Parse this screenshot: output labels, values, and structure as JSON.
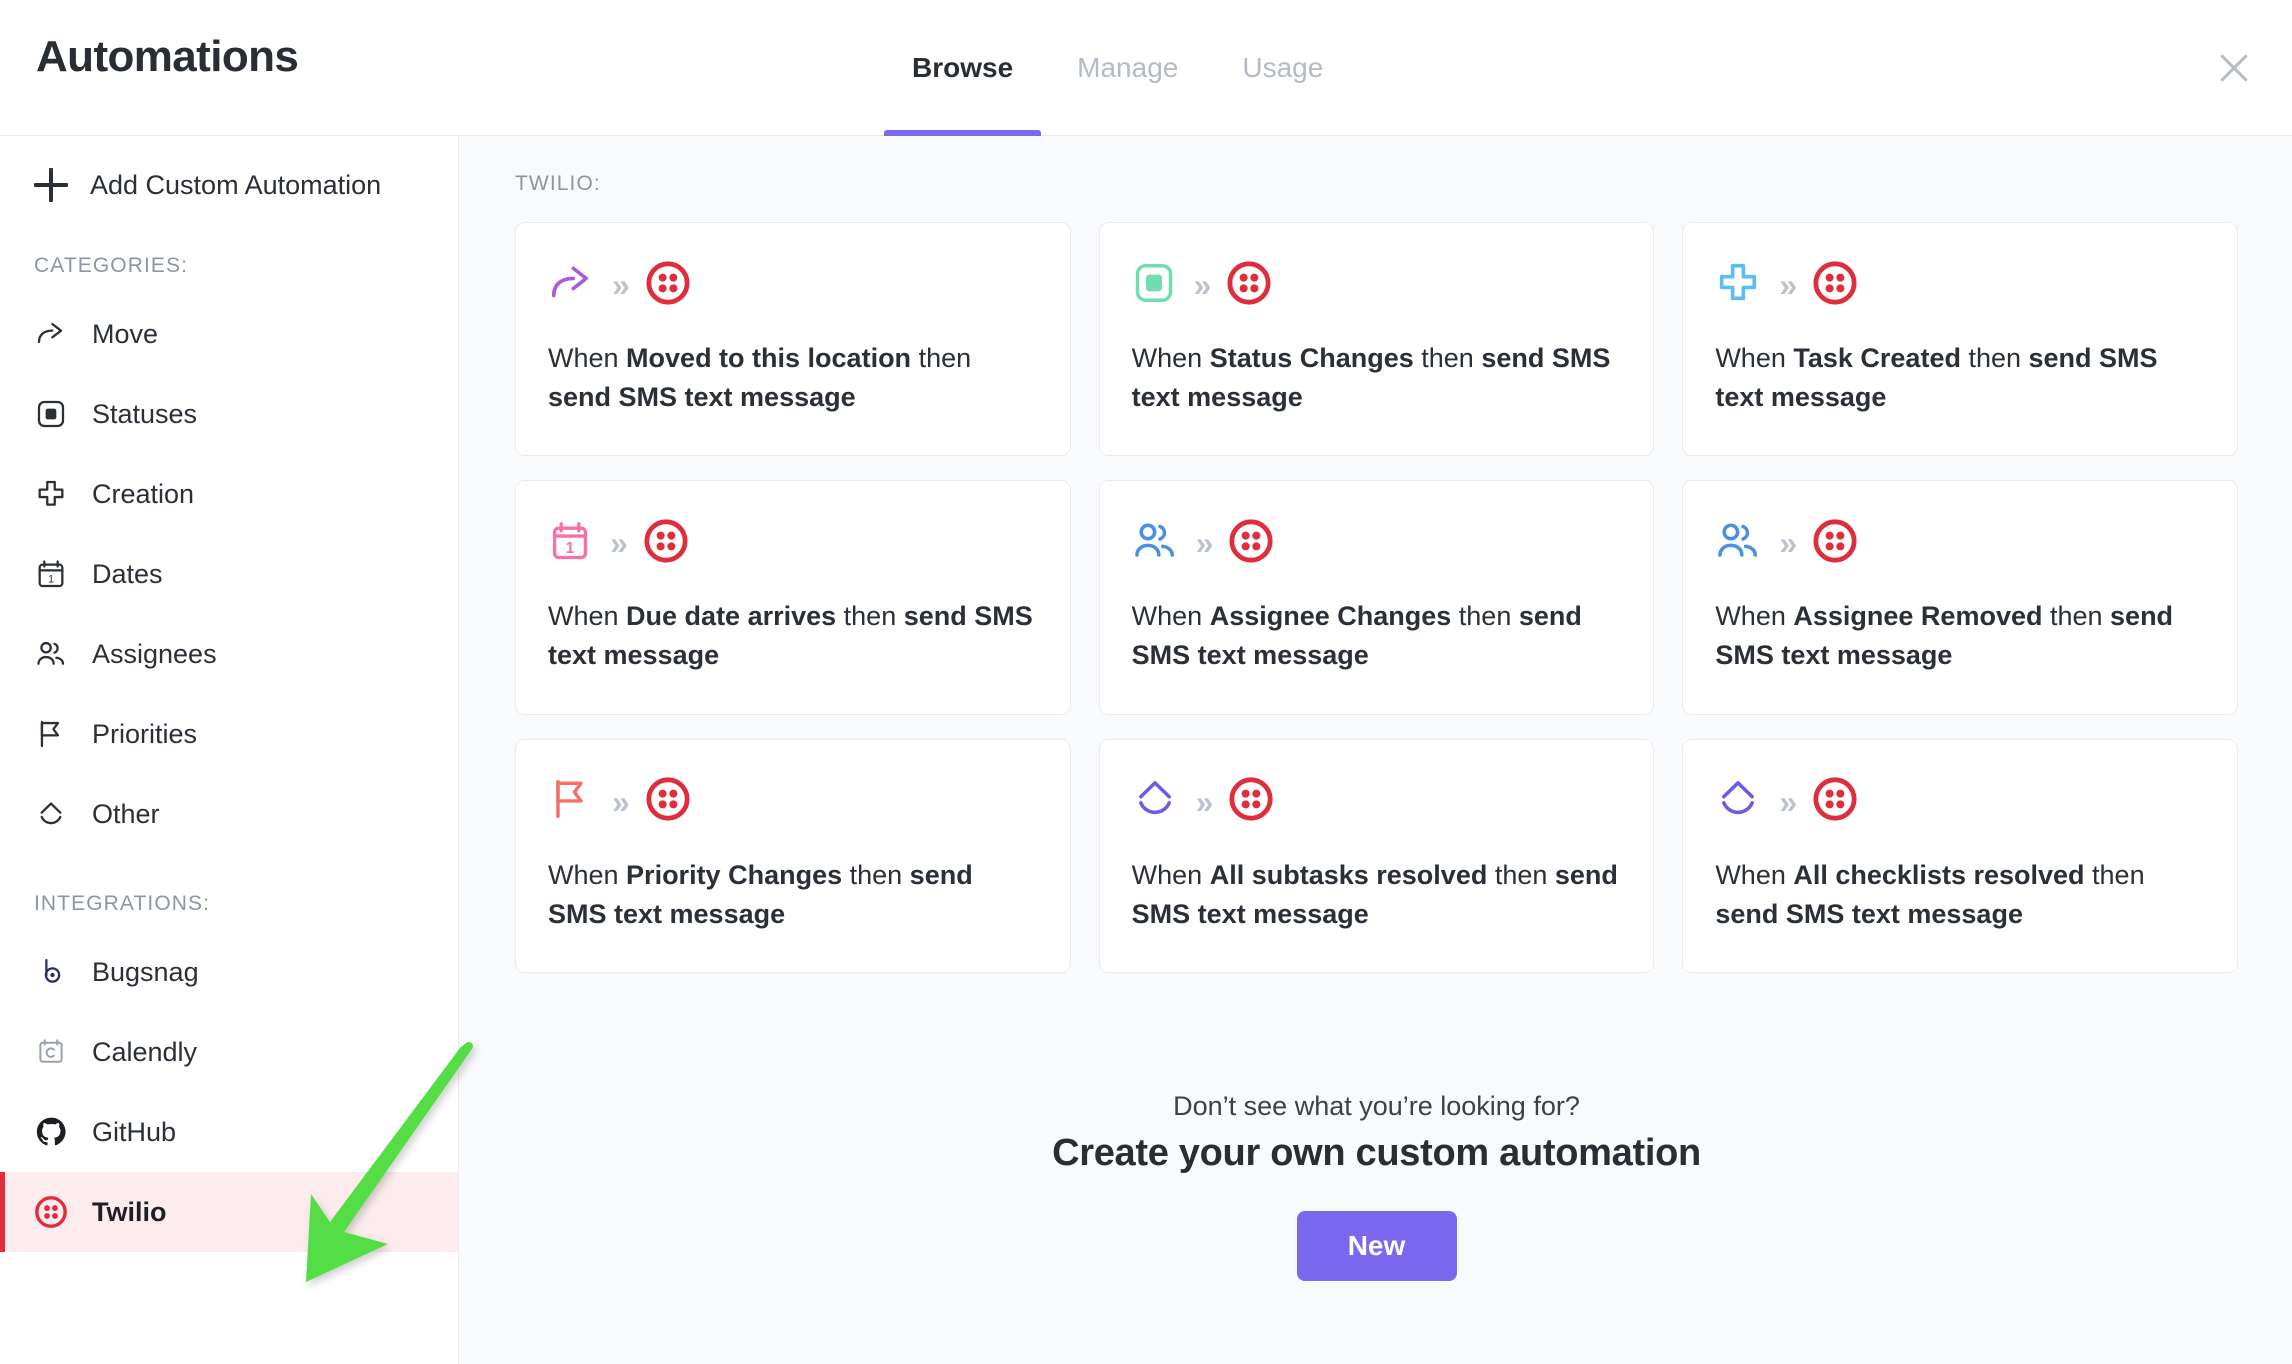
{
  "header": {
    "title": "Automations",
    "tabs": [
      {
        "label": "Browse",
        "active": true
      },
      {
        "label": "Manage",
        "active": false
      },
      {
        "label": "Usage",
        "active": false
      }
    ],
    "close_icon": "close-icon"
  },
  "sidebar": {
    "add_custom_label": "Add Custom Automation",
    "categories_label": "CATEGORIES:",
    "integrations_label": "INTEGRATIONS:",
    "categories": [
      {
        "label": "Move",
        "icon": "share-arrow-icon"
      },
      {
        "label": "Statuses",
        "icon": "status-square-icon"
      },
      {
        "label": "Creation",
        "icon": "plus-thick-icon"
      },
      {
        "label": "Dates",
        "icon": "calendar-icon"
      },
      {
        "label": "Assignees",
        "icon": "people-icon"
      },
      {
        "label": "Priorities",
        "icon": "flag-icon"
      },
      {
        "label": "Other",
        "icon": "chevrons-icon"
      }
    ],
    "integrations": [
      {
        "label": "Bugsnag",
        "icon": "bugsnag-icon",
        "selected": false
      },
      {
        "label": "Calendly",
        "icon": "calendly-icon",
        "selected": false
      },
      {
        "label": "GitHub",
        "icon": "github-icon",
        "selected": false
      },
      {
        "label": "Twilio",
        "icon": "twilio-icon",
        "selected": true
      }
    ]
  },
  "main": {
    "group_label": "TWILIO:",
    "chevron_icon": "chevrons-right-icon",
    "cards": [
      {
        "trigger_icon": "share-arrow-icon",
        "action_icon": "twilio-icon",
        "prefix": "When ",
        "trigger": "Moved to this location",
        "middle": " then ",
        "action": "send SMS text message"
      },
      {
        "trigger_icon": "status-square-icon",
        "action_icon": "twilio-icon",
        "prefix": "When ",
        "trigger": "Status Changes",
        "middle": " then ",
        "action": "send SMS text message"
      },
      {
        "trigger_icon": "plus-thick-icon",
        "action_icon": "twilio-icon",
        "prefix": "When ",
        "trigger": "Task Created",
        "middle": " then ",
        "action": "send SMS text message"
      },
      {
        "trigger_icon": "calendar-icon",
        "action_icon": "twilio-icon",
        "prefix": "When ",
        "trigger": "Due date arrives",
        "middle": " then ",
        "action": "send SMS text message"
      },
      {
        "trigger_icon": "people-icon",
        "action_icon": "twilio-icon",
        "prefix": "When ",
        "trigger": "Assignee Changes",
        "middle": " then ",
        "action": "send SMS text message"
      },
      {
        "trigger_icon": "people-icon",
        "action_icon": "twilio-icon",
        "prefix": "When ",
        "trigger": "Assignee Removed",
        "middle": " then ",
        "action": "send SMS text message"
      },
      {
        "trigger_icon": "flag-icon",
        "action_icon": "twilio-icon",
        "prefix": "When ",
        "trigger": "Priority Changes",
        "middle": " then ",
        "action": "send SMS text message"
      },
      {
        "trigger_icon": "chevrons-icon",
        "action_icon": "twilio-icon",
        "prefix": "When ",
        "trigger": "All subtasks resolved",
        "middle": " then ",
        "action": "send SMS text message"
      },
      {
        "trigger_icon": "chevrons-icon",
        "action_icon": "twilio-icon",
        "prefix": "When ",
        "trigger": "All checklists resolved",
        "middle": " then ",
        "action": "send SMS text message"
      }
    ],
    "cta": {
      "subtitle": "Don’t see what you’re looking for?",
      "title": "Create your own custom automation",
      "button_label": "New"
    }
  },
  "annotation": {
    "arrow_icon": "green-arrow-annotation",
    "color": "#55dd44"
  },
  "colors": {
    "accent_purple": "#7b68ee",
    "twilio_red": "#e02d3c",
    "selected_row_bg": "#fdeced",
    "main_bg": "#f9fafb",
    "annotation_green": "#55dd44"
  }
}
